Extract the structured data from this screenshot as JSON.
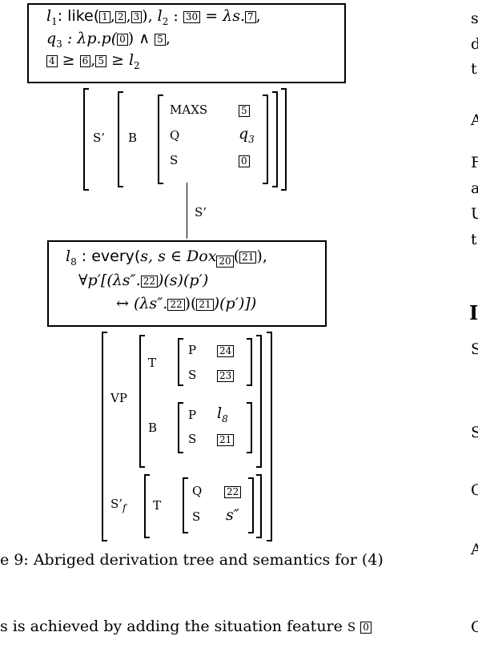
{
  "top_box": {
    "line1": {
      "l1": "l",
      "l1sub": "1",
      "like": ": like(",
      "t1": "1",
      "t2": "2",
      "t3": "3",
      "close1": "), ",
      "l2": "l",
      "l2sub": "2",
      "colon2": " : ",
      "t30": "30",
      "eq": " = λs.",
      "t7": "7",
      "tail": ","
    },
    "line2": {
      "q3": "q",
      "q3sub": "3",
      "mid": " : λp.p(",
      "t0": "0",
      "end": ") ∧ ",
      "t5": "5",
      "tail": ","
    },
    "line3": {
      "t4": "4",
      "ge1": " ≥ ",
      "t6": "6",
      "comma": ",",
      "t5": "5",
      "ge2": " ≥ ",
      "l2": "l",
      "l2sub": "2"
    }
  },
  "avm1": {
    "outer_label": "S’",
    "inner_label": "B",
    "rows": [
      {
        "feat": "MAXS",
        "val_tag": "5"
      },
      {
        "feat": "Q",
        "val": "q",
        "val_sub": "3"
      },
      {
        "feat": "S",
        "val_tag": "0"
      }
    ]
  },
  "edge_label": "S’",
  "mid_box": {
    "line1": {
      "l8": "l",
      "l8sub": "8",
      "every": " : every(",
      "s1": "s, s ∈ Dox",
      "t20": "20",
      "open": "(",
      "t21": "21",
      "close": "),"
    },
    "line2": {
      "forall": "∀p′[(λs″.",
      "t22": "22",
      "rest": ")(s)(p′)"
    },
    "line3": {
      "arrow": "↔ (λs″.",
      "t22": "22",
      "mid": ")(",
      "t21": "21",
      "end": ")(p′)])"
    }
  },
  "avm2": {
    "vp_label": "VP",
    "t_label": "T",
    "t_rows": [
      {
        "feat": "P",
        "val_tag": "24"
      },
      {
        "feat": "S",
        "val_tag": "23"
      }
    ],
    "b_label": "B",
    "b_rows": [
      {
        "feat": "P",
        "val": "l",
        "val_sub": "8"
      },
      {
        "feat": "S",
        "val_tag": "21"
      }
    ],
    "sf_label": "S’",
    "sf_sub": "f",
    "sf_t_label": "T",
    "sf_rows": [
      {
        "feat": "Q",
        "val_tag": "22"
      },
      {
        "feat": "S",
        "val": "s″"
      }
    ]
  },
  "caption": "e 9:  Abriged derivation tree and semantics for (4)",
  "body_text": {
    "before": "s is achieved by adding the situation feature ",
    "feat": "S",
    "tag": "0"
  },
  "right_column": {
    "lines": [
      "s",
      "d",
      "t",
      "A",
      "F",
      "a",
      "U",
      "t",
      "I",
      "S",
      "S",
      "C",
      "A",
      "C"
    ]
  }
}
